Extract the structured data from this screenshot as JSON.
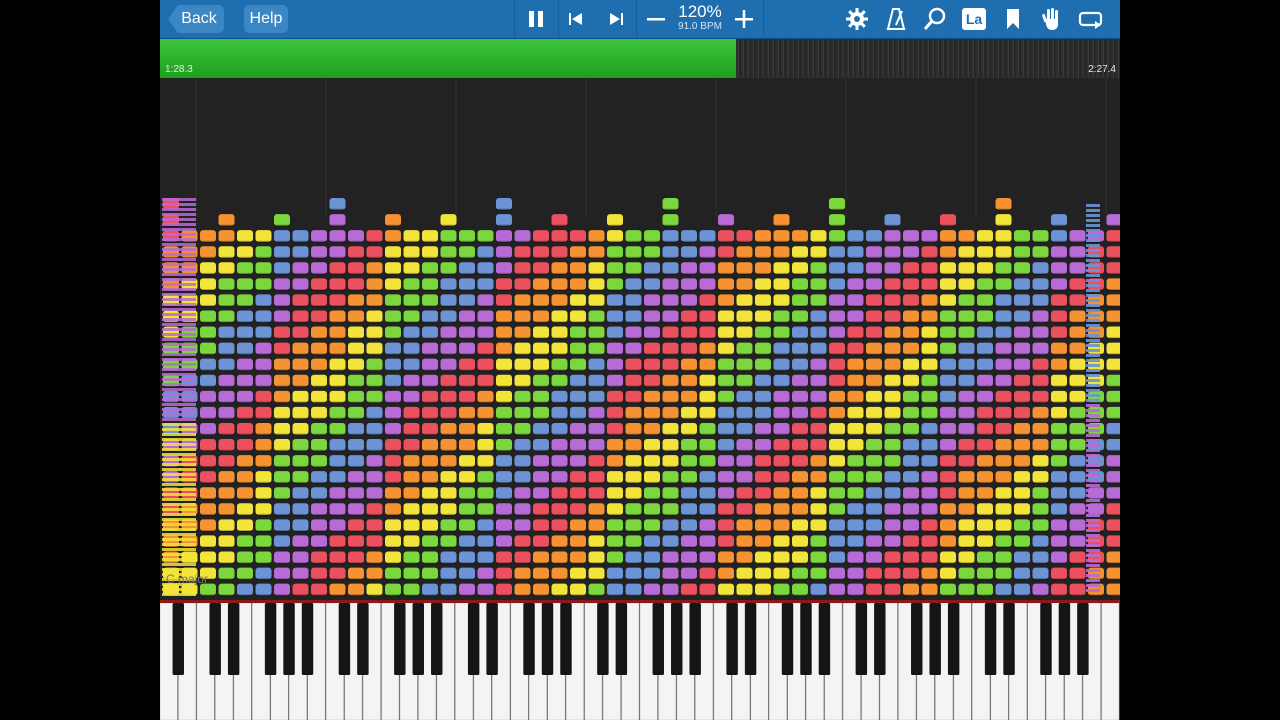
{
  "toolbar": {
    "back_label": "Back",
    "help_label": "Help",
    "zoom": "120%",
    "bpm": "91.0 BPM",
    "icons": [
      "pause-icon",
      "skip-back-icon",
      "skip-forward-icon",
      "minus-icon",
      "plus-icon",
      "settings-gear-icon",
      "metronome-icon",
      "magnifier-icon",
      "note-label-icon",
      "bookmark-icon",
      "hand-icon",
      "loop-icon"
    ],
    "note_label_text": "La"
  },
  "progress": {
    "current_time": "1:28.3",
    "total_time": "2:27.4",
    "fraction": 0.6
  },
  "notes_view": {
    "key_signature": "C major",
    "colors": [
      "#ec4f5e",
      "#f6922f",
      "#f3e43a",
      "#7bd83c",
      "#6b93d6",
      "#b86ad6"
    ]
  },
  "keyboard": {
    "white_keys": 52
  }
}
